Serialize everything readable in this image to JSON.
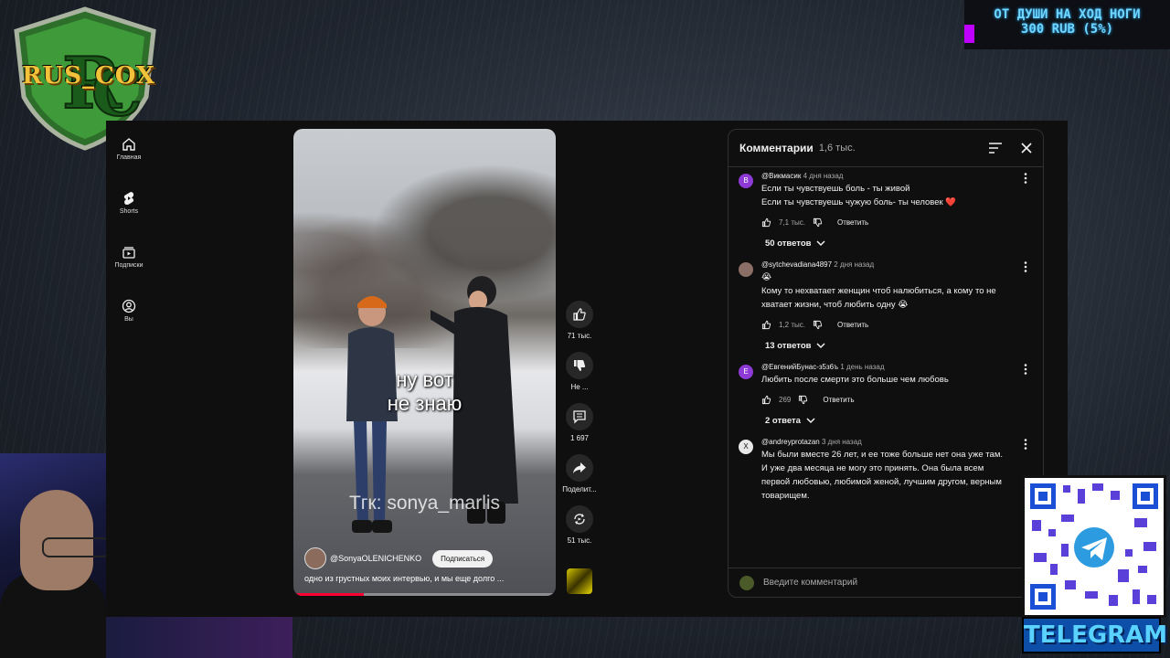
{
  "overlay": {
    "logo_text": "RUS_COX",
    "donation_title": "ОТ ДУШИ НА ХОД НОГИ",
    "donation_amount": "300 RUB (5%)",
    "telegram_label": "TELEGRAM"
  },
  "sidebar": {
    "items": [
      {
        "label": "Главная",
        "icon": "home-icon"
      },
      {
        "label": "Shorts",
        "icon": "shorts-icon"
      },
      {
        "label": "Подписки",
        "icon": "subscriptions-icon"
      },
      {
        "label": "Вы",
        "icon": "profile-icon"
      }
    ]
  },
  "video": {
    "caption_line1": "ну вот",
    "caption_line2": "не знаю",
    "watermark": "Тгк: sonya_marlis",
    "channel": "@SonyaOLENICHENKO",
    "subscribe_label": "Подписаться",
    "description": "одно из грустных моих интервью, и мы еще долго ...",
    "progress": 0.27
  },
  "actions": {
    "likes": "71 тыс.",
    "dislike": "Не ...",
    "comments": "1 697",
    "share": "Поделит...",
    "remix": "51 тыс."
  },
  "comments_panel": {
    "title": "Комментарии",
    "count": "1,6 тыс.",
    "input_placeholder": "Введите комментарий",
    "reply_label": "Ответить",
    "items": [
      {
        "author": "@Викмасик",
        "time": "4 дня назад",
        "avatar_letter": "В",
        "avatar_color": "#8e3ad6",
        "lines": [
          "Если ты чувствуешь боль - ты живой",
          "Если ты чувствуешь чужую боль- ты человек ❤️"
        ],
        "likes": "7,1 тыс.",
        "replies": "50 ответов"
      },
      {
        "author": "@sytchevadiana4897",
        "time": "2 дня назад",
        "avatar_letter": "",
        "avatar_color": "#8b6f66",
        "lines": [
          "😭",
          "Кому то нехватает женщин чтоб налюбиться, а кому то не",
          "хватает жизни, чтоб любить одну 😭"
        ],
        "likes": "1,2 тыс.",
        "replies": "13 ответов"
      },
      {
        "author": "@ЕвгенийБунас-з5з6ъ",
        "time": "1 день назад",
        "avatar_letter": "Е",
        "avatar_color": "#8e3ad6",
        "lines": [
          "Любить после смерти это больше чем любовь"
        ],
        "likes": "269",
        "replies": "2 ответа"
      },
      {
        "author": "@andreyprotazan",
        "time": "3 дня назад",
        "avatar_letter": "X",
        "avatar_color": "#e8e8e8",
        "lines": [
          "Мы были вместе 26 лет, и ее тоже больше нет она уже там.",
          "И уже два месяца не могу это принять. Она была всем",
          "первой любовью, любимой женой, лучшим другом, верным",
          "товарищем."
        ],
        "likes": "",
        "replies": ""
      }
    ]
  }
}
